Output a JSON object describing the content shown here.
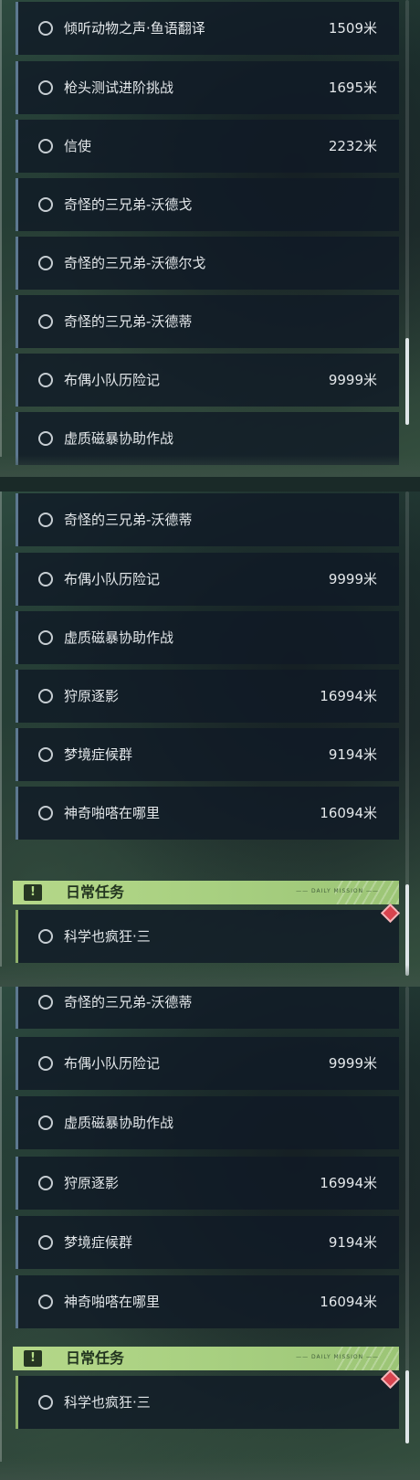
{
  "panel1": {
    "tasks": [
      {
        "name": "倾听动物之声·鱼语翻译",
        "distance": "1509米"
      },
      {
        "name": "枪头测试进阶挑战",
        "distance": "1695米"
      },
      {
        "name": "信使",
        "distance": "2232米"
      },
      {
        "name": "奇怪的三兄弟-沃德戈",
        "distance": ""
      },
      {
        "name": "奇怪的三兄弟-沃德尔戈",
        "distance": ""
      },
      {
        "name": "奇怪的三兄弟-沃德蒂",
        "distance": ""
      },
      {
        "name": "布偶小队历险记",
        "distance": "9999米"
      },
      {
        "name": "虚质磁暴协助作战",
        "distance": ""
      }
    ]
  },
  "panel2": {
    "tasks": [
      {
        "name": "奇怪的三兄弟-沃德蒂",
        "distance": ""
      },
      {
        "name": "布偶小队历险记",
        "distance": "9999米"
      },
      {
        "name": "虚质磁暴协助作战",
        "distance": ""
      },
      {
        "name": "狩原逐影",
        "distance": "16994米"
      },
      {
        "name": "梦境症候群",
        "distance": "9194米"
      },
      {
        "name": "神奇啪嗒在哪里",
        "distance": "16094米"
      }
    ],
    "section_title": "日常任务",
    "section_badge": "!",
    "section_deco": "—— DAILY MISSION ——",
    "daily_tasks": [
      {
        "name": "科学也疯狂·三",
        "distance": ""
      }
    ]
  },
  "panel3": {
    "tasks": [
      {
        "name": "奇怪的三兄弟-沃德蒂",
        "distance": ""
      },
      {
        "name": "布偶小队历险记",
        "distance": "9999米"
      },
      {
        "name": "虚质磁暴协助作战",
        "distance": ""
      },
      {
        "name": "狩原逐影",
        "distance": "16994米"
      },
      {
        "name": "梦境症候群",
        "distance": "9194米"
      },
      {
        "name": "神奇啪嗒在哪里",
        "distance": "16094米"
      }
    ],
    "section_title": "日常任务",
    "section_badge": "!",
    "section_deco": "—— DAILY MISSION ——",
    "daily_tasks": [
      {
        "name": "科学也疯狂·三",
        "distance": ""
      }
    ]
  },
  "colors": {
    "row_bg": "#101a26",
    "row_accent": "#5d7890",
    "daily_accent": "#8fb06a",
    "header_green": "#b5d889",
    "alert_red": "#d8444f"
  },
  "icons": [
    "radio-ring-icon",
    "exclamation-icon",
    "red-diamond-marker-icon"
  ]
}
